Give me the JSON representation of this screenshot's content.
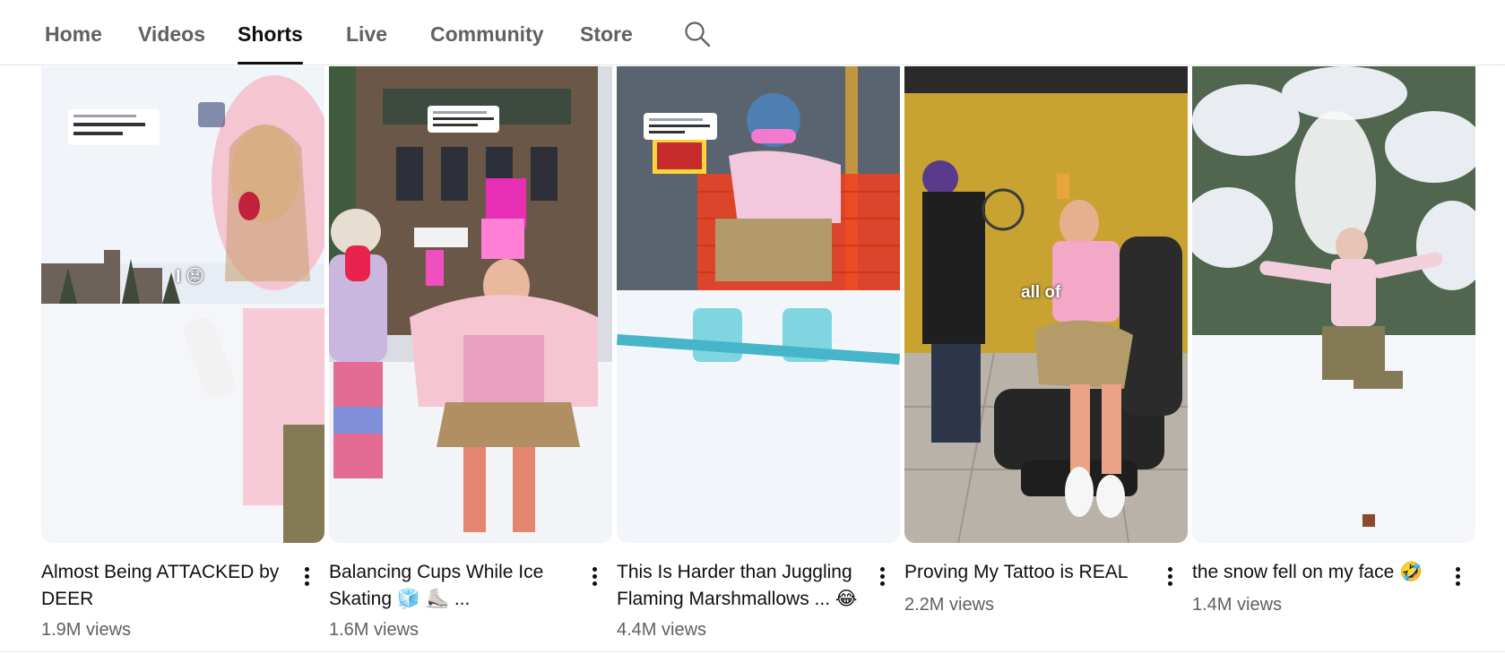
{
  "tabs": [
    {
      "label": "Home"
    },
    {
      "label": "Videos"
    },
    {
      "label": "Shorts"
    },
    {
      "label": "Live"
    },
    {
      "label": "Community"
    },
    {
      "label": "Store"
    }
  ],
  "active_tab": "Shorts",
  "search_icon": "search-icon",
  "shorts": [
    {
      "title": "Almost Being ATTACKED by DEER",
      "views": "1.9M views"
    },
    {
      "title": "Balancing Cups While Ice Skating 🧊 ⛸️ ...",
      "views": "1.6M views"
    },
    {
      "title": "This Is Harder than Juggling Flaming Marshmallows ... 😂",
      "views": "4.4M views"
    },
    {
      "title": "Proving My Tattoo is REAL",
      "views": "2.2M views"
    },
    {
      "title": "the snow fell on my face 🤣",
      "views": "1.4M views"
    }
  ],
  "thumb_overlays": {
    "s1_caption": "I 😟",
    "s4_caption": "all of"
  },
  "colors": {
    "accent_pink": "#f5b8cf",
    "active_tab_text": "#0f0f0f",
    "inactive_tab_text": "#606060",
    "meta_text": "#606060"
  }
}
